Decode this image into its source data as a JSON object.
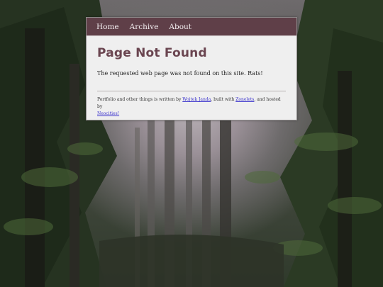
{
  "nav": {
    "items": [
      {
        "label": "Home"
      },
      {
        "label": "Archive"
      },
      {
        "label": "About"
      }
    ]
  },
  "page": {
    "title": "Page Not Found",
    "message": "The requested web page was not found on this site. Rats!"
  },
  "footer": {
    "text_1": "Portfolio and other things is written by ",
    "author_link": "Wojtek Janda",
    "text_2": ", built with ",
    "builder_link": "Zonelets",
    "text_3": ", and hosted by ",
    "host_link": "Neocities!"
  },
  "colors": {
    "nav_bg": "#5f3f48",
    "title": "#6a4550",
    "link": "#3b33cc"
  }
}
